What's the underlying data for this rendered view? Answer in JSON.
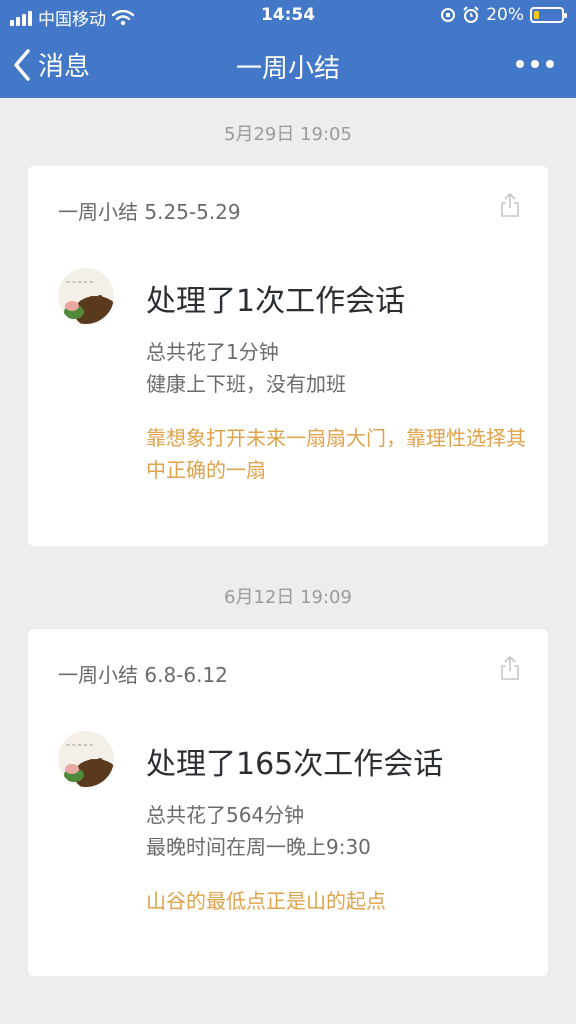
{
  "status_bar": {
    "carrier": "中国移动",
    "time": "14:54",
    "battery": "20%",
    "battery_level": 0.2,
    "icons": [
      "signal-icon",
      "wifi-icon",
      "screen-rotation-lock-icon",
      "alarm-icon",
      "battery-icon"
    ]
  },
  "nav": {
    "back_label": "消息",
    "title": "一周小结"
  },
  "messages": [
    {
      "timestamp": "5月29日 19:05",
      "card_title": "一周小结 5.25-5.29",
      "headline": "处理了1次工作会话",
      "line1": "总共花了1分钟",
      "line2": "健康上下班，没有加班",
      "quote": "靠想象打开未来一扇扇大门，靠理性选择其中正确的一扇"
    },
    {
      "timestamp": "6月12日 19:09",
      "card_title": "一周小结 6.8-6.12",
      "headline": "处理了165次工作会话",
      "line1": "总共花了564分钟",
      "line2": "最晚时间在周一晚上9:30",
      "quote": "山谷的最低点正是山的起点"
    }
  ],
  "colors": {
    "header": "#4378c8",
    "quote": "#e0a24a",
    "background": "#ededed"
  }
}
